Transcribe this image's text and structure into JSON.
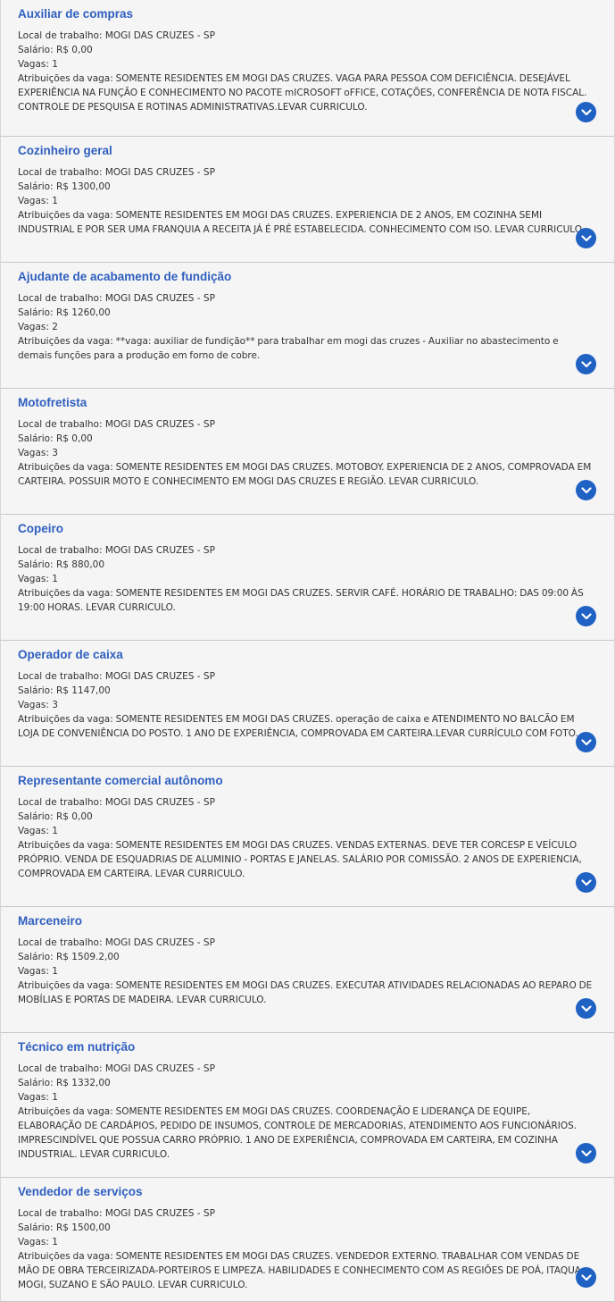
{
  "labels": {
    "local": "Local de trabalho: ",
    "salario": "Salário: ",
    "vagas": "Vagas: ",
    "atribuicoes": "Atribuições da vaga: "
  },
  "theme": {
    "title_color": "#2f5fbf",
    "button_color": "#1f62c4",
    "card_background": "#f5f5f5"
  },
  "expand_icon": "chevron-down-icon",
  "jobs": [
    {
      "title": "Auxiliar de compras",
      "local": "MOGI DAS CRUZES - SP",
      "salario": "R$ 0,00",
      "vagas": "1",
      "atribuicoes": "SOMENTE RESIDENTES EM MOGI DAS CRUZES. VAGA PARA PESSOA COM DEFICIÊNCIA. DESEJÁVEL EXPERIÊNCIA NA FUNÇÃO E CONHECIMENTO NO PACOTE mICROSOFT oFFICE, COTAÇÕES, CONFERÊNCIA DE NOTA FISCAL. CONTROLE DE PESQUISA E ROTINAS ADMINISTRATIVAS.LEVAR CURRICULO."
    },
    {
      "title": "Cozinheiro geral",
      "local": "MOGI DAS CRUZES - SP",
      "salario": "R$ 1300,00",
      "vagas": "1",
      "atribuicoes": "SOMENTE RESIDENTES EM MOGI DAS CRUZES. EXPERIENCIA DE 2 ANOS, EM COZINHA SEMI INDUSTRIAL E POR SER UMA FRANQUIA A RECEITA JÁ É PRÉ ESTABELECIDA. CONHECIMENTO COM ISO. LEVAR CURRICULO."
    },
    {
      "title": "Ajudante de acabamento de fundição",
      "local": "MOGI DAS CRUZES - SP",
      "salario": "R$ 1260,00",
      "vagas": "2",
      "atribuicoes": "**vaga: auxiliar de fundição** para trabalhar em mogi das cruzes - Auxiliar no abastecimento e demais funções para a produção em forno de cobre."
    },
    {
      "title": "Motofretista",
      "local": "MOGI DAS CRUZES - SP",
      "salario": "R$ 0,00",
      "vagas": "3",
      "atribuicoes": "SOMENTE RESIDENTES EM MOGI DAS CRUZES. MOTOBOY. EXPERIENCIA DE 2 ANOS, COMPROVADA EM CARTEIRA. POSSUIR MOTO E CONHECIMENTO EM MOGI DAS CRUZES E REGIÃO. LEVAR CURRICULO."
    },
    {
      "title": "Copeiro",
      "local": "MOGI DAS CRUZES - SP",
      "salario": "R$ 880,00",
      "vagas": "1",
      "atribuicoes": "SOMENTE RESIDENTES EM MOGI DAS CRUZES. SERVIR CAFÉ. HORÁRIO DE TRABALHO: DAS 09:00 ÀS 19:00 HORAS. LEVAR CURRICULO."
    },
    {
      "title": "Operador de caixa",
      "local": "MOGI DAS CRUZES - SP",
      "salario": "R$ 1147,00",
      "vagas": "3",
      "atribuicoes": "SOMENTE RESIDENTES EM MOGI DAS CRUZES. operação de caixa e ATENDIMENTO NO BALCÃO EM LOJA DE CONVENIÊNCIA DO POSTO. 1 ANO DE EXPERIÊNCIA, COMPROVADA EM CARTEIRA.LEVAR CURRÍCULO COM FOTO."
    },
    {
      "title": "Representante comercial autônomo",
      "local": "MOGI DAS CRUZES - SP",
      "salario": "R$ 0,00",
      "vagas": "1",
      "atribuicoes": "SOMENTE RESIDENTES EM MOGI DAS CRUZES. VENDAS EXTERNAS. DEVE TER CORCESP E VEÍCULO PRÓPRIO. VENDA DE ESQUADRIAS DE ALUMINIO - PORTAS E JANELAS. SALÁRIO POR COMISSÃO. 2 ANOS DE EXPERIENCIA, COMPROVADA EM CARTEIRA. LEVAR CURRICULO."
    },
    {
      "title": "Marceneiro",
      "local": "MOGI DAS CRUZES - SP",
      "salario": "R$ 1509.2,00",
      "vagas": "1",
      "atribuicoes": "SOMENTE RESIDENTES EM MOGI DAS CRUZES. EXECUTAR ATIVIDADES RELACIONADAS AO REPARO DE MOBÍLIAS E PORTAS DE MADEIRA. LEVAR CURRICULO."
    },
    {
      "title": "Técnico em nutrição",
      "local": "MOGI DAS CRUZES - SP",
      "salario": "R$ 1332,00",
      "vagas": "1",
      "atribuicoes": "SOMENTE RESIDENTES EM MOGI DAS CRUZES. COORDENAÇÃO E LIDERANÇA DE EQUIPE, ELABORAÇÃO DE CARDÁPIOS, PEDIDO DE INSUMOS, CONTROLE DE MERCADORIAS, ATENDIMENTO AOS FUNCIONÁRIOS. IMPRESCINDÍVEL QUE POSSUA CARRO PRÓPRIO. 1 ANO DE EXPERIÊNCIA, COMPROVADA EM CARTEIRA, EM COZINHA INDUSTRIAL. LEVAR CURRICULO."
    },
    {
      "title": "Vendedor de serviços",
      "local": "MOGI DAS CRUZES - SP",
      "salario": "R$ 1500,00",
      "vagas": "1",
      "atribuicoes": "SOMENTE RESIDENTES EM MOGI DAS CRUZES. VENDEDOR EXTERNO. TRABALHAR COM VENDAS DE MÃO DE OBRA TERCEIRIZADA-PORTEIROS E LIMPEZA. HABILIDADES E CONHECIMENTO COM AS REGIÕES DE POÁ, ITAQUA, MOGI, SUZANO E SÃO PAULO. LEVAR CURRICULO."
    }
  ]
}
